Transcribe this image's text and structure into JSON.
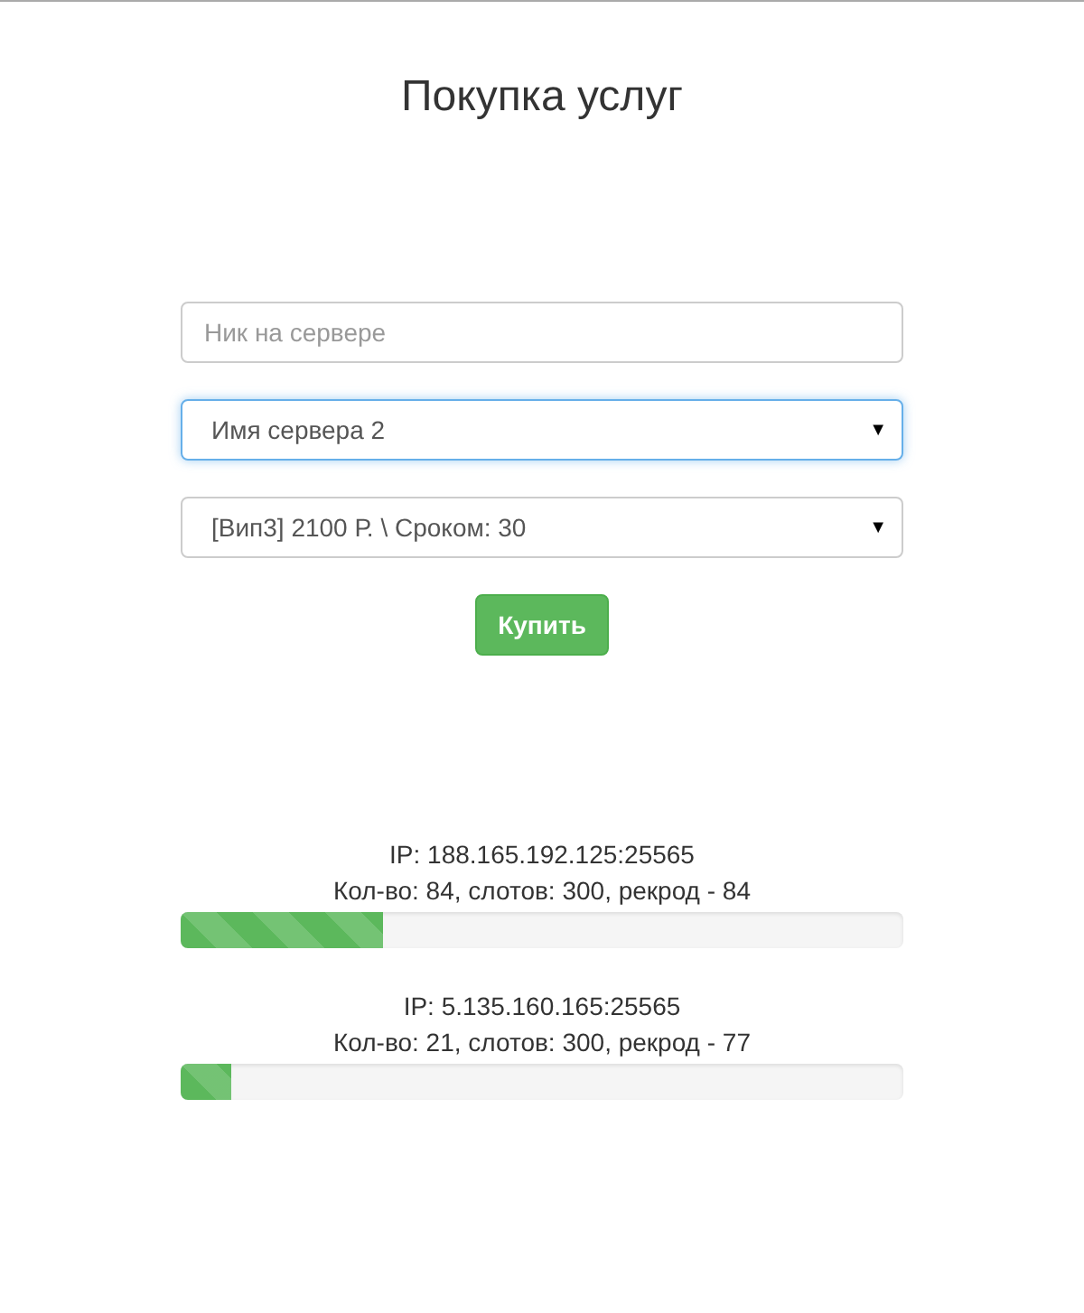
{
  "title": "Покупка услуг",
  "form": {
    "nick": {
      "placeholder": "Ник на сервере"
    },
    "selects": [
      {
        "value": "Имя сервера 2",
        "focused": true,
        "arrow": "▼"
      },
      {
        "value": "[Вип3] 2100 Р. \\ Сроком: 30",
        "focused": false,
        "arrow": "▼"
      }
    ],
    "button": "Купить"
  },
  "servers": [
    {
      "ip": "IP: 188.165.192.125:25565",
      "stats": "Кол-во: 84, слотов: 300, рекрод - 84",
      "level": 0.28
    },
    {
      "ip": "IP: 5.135.160.165:25565",
      "stats": "Кол-во: 21, слотов: 300, рекрод - 77",
      "level": 0.07
    }
  ]
}
